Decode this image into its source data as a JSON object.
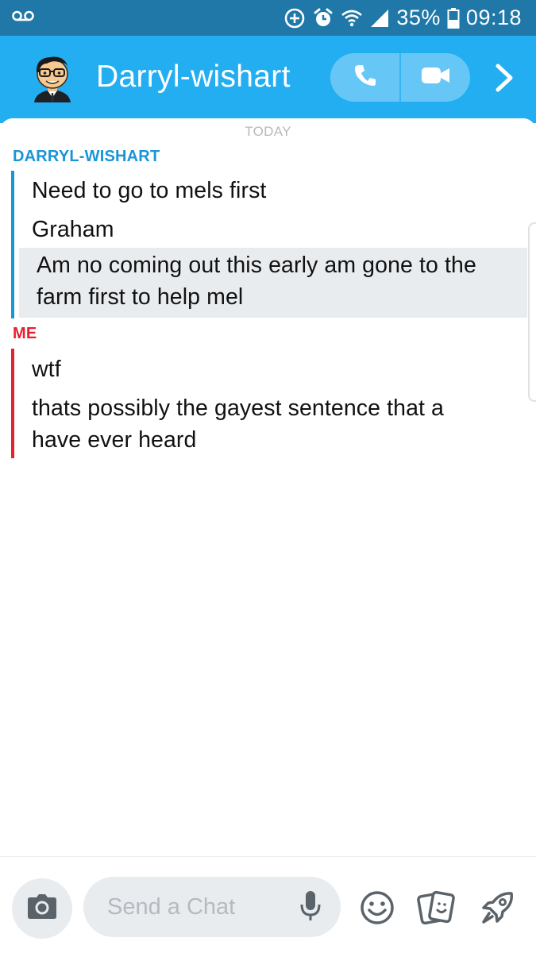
{
  "status_bar": {
    "battery": "35%",
    "time": "09:18",
    "icons": [
      "voicemail-icon",
      "data-saver-icon",
      "alarm-icon",
      "wifi-icon",
      "signal-icon",
      "battery-icon"
    ]
  },
  "header": {
    "contact_name": "Darryl-wishart",
    "icons": [
      "bitmoji-avatar",
      "phone-icon",
      "video-camera-icon",
      "chevron-right-icon"
    ]
  },
  "conversation": {
    "day_label": "TODAY",
    "groups": [
      {
        "sender": "DARRYL-WISHART",
        "color": "#1a95d7",
        "messages": [
          "Need to go to mels first",
          "Graham",
          "Am no coming out this early am gone to the farm first to help mel"
        ]
      },
      {
        "sender": "ME",
        "color": "#ea1e2c",
        "messages": [
          "wtf",
          "thats possibly the gayest sentence that a have ever heard"
        ]
      }
    ]
  },
  "composer": {
    "placeholder": "Send a Chat",
    "value": "",
    "icons": [
      "camera-icon",
      "microphone-icon",
      "smiley-icon",
      "stickers-icon",
      "rocket-icon"
    ]
  },
  "colors": {
    "status_bar": "#1f78a7",
    "header": "#24aef2",
    "call_pill": "#66c7f6",
    "them_accent": "#1a95d7",
    "me_accent": "#ea1e2c",
    "highlight_bg": "#e9ecef"
  }
}
